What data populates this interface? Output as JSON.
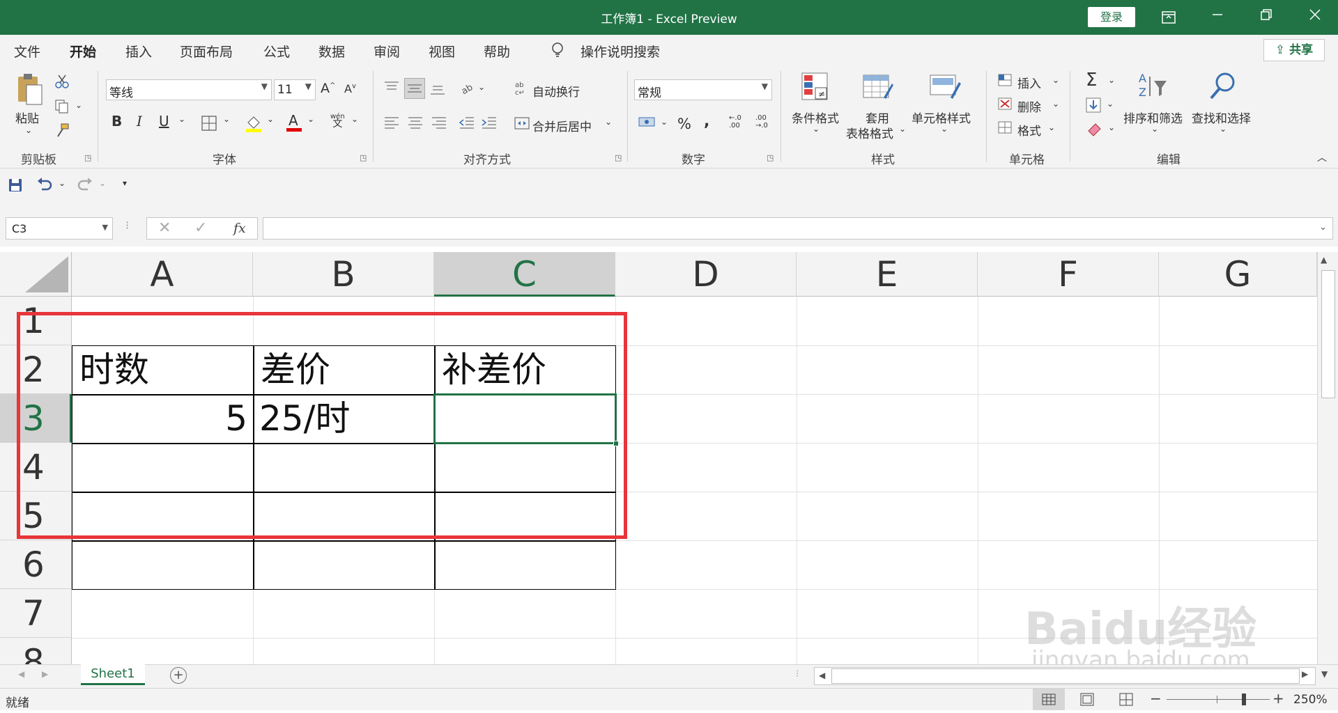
{
  "window": {
    "title": "工作簿1  -  Excel Preview",
    "login_label": "登录"
  },
  "tabs": [
    {
      "label": "文件"
    },
    {
      "label": "开始"
    },
    {
      "label": "插入"
    },
    {
      "label": "页面布局"
    },
    {
      "label": "公式"
    },
    {
      "label": "数据"
    },
    {
      "label": "审阅"
    },
    {
      "label": "视图"
    },
    {
      "label": "帮助"
    }
  ],
  "tell_me": "操作说明搜索",
  "share_label": "共享",
  "ribbon": {
    "clipboard": {
      "paste": "粘贴",
      "group": "剪贴板"
    },
    "font": {
      "name": "等线",
      "size": "11",
      "group": "字体",
      "phonetic_top": "wén",
      "phonetic_bottom": "文"
    },
    "alignment": {
      "wrap": "自动换行",
      "merge": "合并后居中",
      "group": "对齐方式"
    },
    "number": {
      "format": "常规",
      "group": "数字"
    },
    "styles": {
      "conditional": "条件格式",
      "table_line1": "套用",
      "table_line2": "表格格式",
      "cell_styles": "单元格样式",
      "group": "样式"
    },
    "cells": {
      "insert": "插入",
      "delete": "删除",
      "format": "格式",
      "group": "单元格"
    },
    "editing": {
      "sort": "排序和筛选",
      "find": "查找和选择",
      "group": "编辑"
    }
  },
  "formula_bar": {
    "name_box": "C3",
    "fx": "fx",
    "value": ""
  },
  "columns": [
    "A",
    "B",
    "C",
    "D",
    "E",
    "F",
    "G"
  ],
  "rows": [
    "1",
    "2",
    "3",
    "4",
    "5",
    "6",
    "7",
    "8"
  ],
  "cells": {
    "A2": "时数",
    "B2": "差价",
    "C2": "补差价",
    "A3": "5",
    "B3": "25/时"
  },
  "selected_cell": "C3",
  "sheet_tab": "Sheet1",
  "status": {
    "mode": "就绪",
    "zoom": "250%"
  },
  "watermark": {
    "line1": "Baidu经验",
    "line2": "jingyan.baidu.com"
  },
  "colors": {
    "brand": "#217346",
    "highlight_box": "#e8353a"
  }
}
